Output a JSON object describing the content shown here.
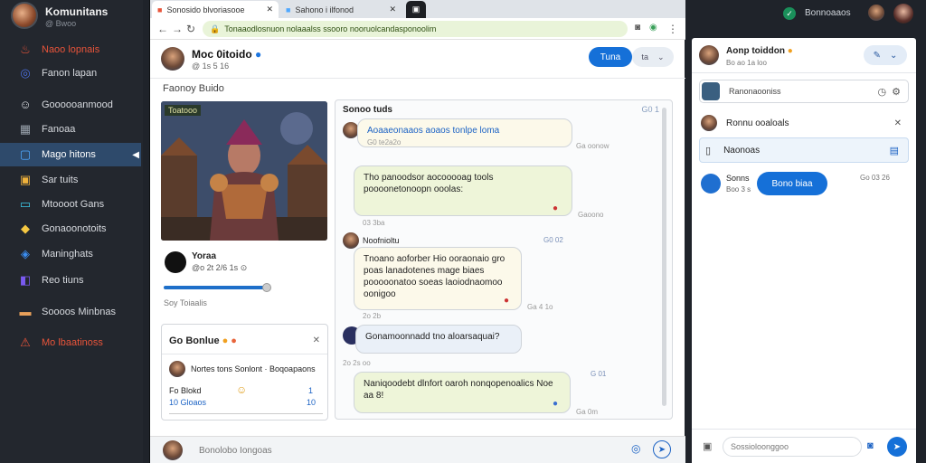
{
  "sidebar": {
    "title": "Komunitans",
    "subtitle": "@ Bwoo",
    "items": [
      {
        "label": "Naoo lopnais",
        "icon": "fire-icon",
        "color": "#e8543a"
      },
      {
        "label": "Fanon lapan",
        "icon": "compass-icon",
        "color": "#4b6fe0"
      },
      {
        "label": "Goooooanmood",
        "icon": "people-icon",
        "color": "#d8dbe0"
      },
      {
        "label": "Fanoaa",
        "icon": "grid-icon",
        "color": "#9aa3ad"
      },
      {
        "label": "Mago hitons",
        "icon": "square-icon",
        "color": "#4fa8ff"
      },
      {
        "label": "Sar tuits",
        "icon": "briefcase-icon",
        "color": "#f0b23c"
      },
      {
        "label": "Mtoooot Gans",
        "icon": "monitor-icon",
        "color": "#3cc7e6"
      },
      {
        "label": "Gonaoonotoits",
        "icon": "bell-icon",
        "color": "#f5c842"
      },
      {
        "label": "Maninghats",
        "icon": "bucket-icon",
        "color": "#3a8df0"
      },
      {
        "label": "Reo tiuns",
        "icon": "puzzle-icon",
        "color": "#7a5af0"
      },
      {
        "label": "Soooos Minbnas",
        "icon": "folder-icon",
        "color": "#e8a05a"
      },
      {
        "label": "Mo lbaatinoss",
        "icon": "alert-icon",
        "color": "#e8543a"
      }
    ]
  },
  "browser": {
    "tabs": [
      {
        "label": "Sonosido blvoriasooe"
      },
      {
        "label": "Sahono i ilfonod"
      },
      {
        "label": ""
      }
    ],
    "url": "Tonaaodlosnuon nolaaalss ssooro nooruolcandasponoolim"
  },
  "profile": {
    "name": "Moc 0itoido",
    "handle": "@ 1s 5 16",
    "follow_label": "Tuna",
    "more_label": "ta",
    "section": "Faonoy Buido"
  },
  "media": {
    "tag": "Toatooo",
    "author": "Yoraa",
    "stats": "@o 2t 2/6 1s",
    "caption": "Soy  Toiaalis"
  },
  "card": {
    "title": "Go Bonlue",
    "row1": "Nortes tons Sonlont · Boqoapaons",
    "row2_name": "Fo  Blokd",
    "row2_count": "1",
    "row2_sub": "10 Gloaos",
    "row2_count2": "10"
  },
  "chat": {
    "title": "Sonoo tuds",
    "title_meta": "G0 1",
    "messages": [
      {
        "side": "left",
        "text": "Aoaaeonaaos aoaos tonlpe loma",
        "sub": "G0 te2a2o",
        "meta": "Ga oonow",
        "color": "yellow"
      },
      {
        "side": "right",
        "text": "Tho panoodsor aocooooag tools poooonetonoopn ooolas:",
        "meta": "03 3ba",
        "time": "Gaoono",
        "color": "green"
      },
      {
        "side": "left",
        "text": "Tnoano aoforber Hio ooraonaio gro poas lanadotenes mage biaes pooooonatoo soeas laoiodnaomoo oonigoo",
        "sub": "Noofnioltu",
        "meta": "Ga 4 1o",
        "time": "G0 02",
        "color": "yellow"
      },
      {
        "side": "left",
        "text": "Gonamoonnadd tno aloarsaquai?",
        "meta": "2o 2s oo",
        "time": "",
        "color": "blue"
      },
      {
        "side": "right",
        "text": "Naniqoodebt dlnfort oaroh nonqopenoalics Noe aa 8!",
        "meta": "G 01",
        "time": "Ga 0m",
        "color": "green"
      }
    ]
  },
  "composer": {
    "placeholder": "Bonolobo Iongoas"
  },
  "topright": {
    "label": "Bonnoaaos"
  },
  "right": {
    "header_name": "Aonp toiddon",
    "header_sub": "Bo ao 1a loo",
    "search_text": "Ranonaooniss",
    "item1": "Ronnu ooaloals",
    "item2": "Naonoas",
    "chat_name": "Sonns",
    "chat_sub": "Boo 3 s",
    "chat_button": "Bono biaa",
    "chat_time": "Go 03 26",
    "composer_placeholder": "Sossioloonggoo"
  }
}
